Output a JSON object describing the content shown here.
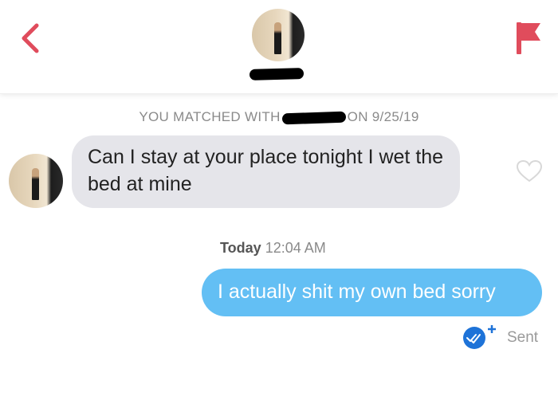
{
  "colors": {
    "accent": "#e04c5c",
    "incoming_bubble": "#e5e5ea",
    "outgoing_bubble": "#63bff4",
    "read_receipt": "#1e73d8"
  },
  "header": {
    "back_icon": "chevron-left-icon",
    "report_icon": "flag-icon"
  },
  "match_banner": {
    "prefix": "YOU MATCHED WITH",
    "suffix": "ON 9/25/19"
  },
  "messages": {
    "incoming": {
      "text": "Can I stay at your place tonight I wet the bed at mine"
    },
    "timestamp_day": "Today",
    "timestamp_time": "12:04 AM",
    "outgoing": {
      "text": "I actually shit my own bed sorry",
      "status": "Sent"
    }
  },
  "icons": {
    "like": "heart-outline-icon",
    "read_receipt": "read-receipt-plus-icon"
  }
}
